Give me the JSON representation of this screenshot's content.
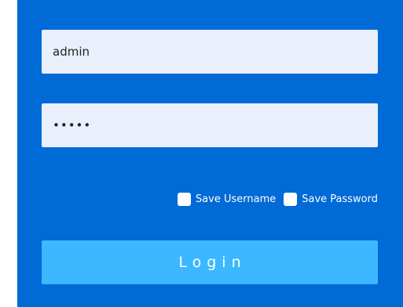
{
  "form": {
    "username_value": "admin",
    "password_value": "•••••",
    "save_username_label": "Save Username",
    "save_password_label": "Save Password",
    "login_label": "Login"
  },
  "colors": {
    "panel_background": "#006ad6",
    "input_background": "#e9effb",
    "login_button": "#3bb8ff"
  }
}
